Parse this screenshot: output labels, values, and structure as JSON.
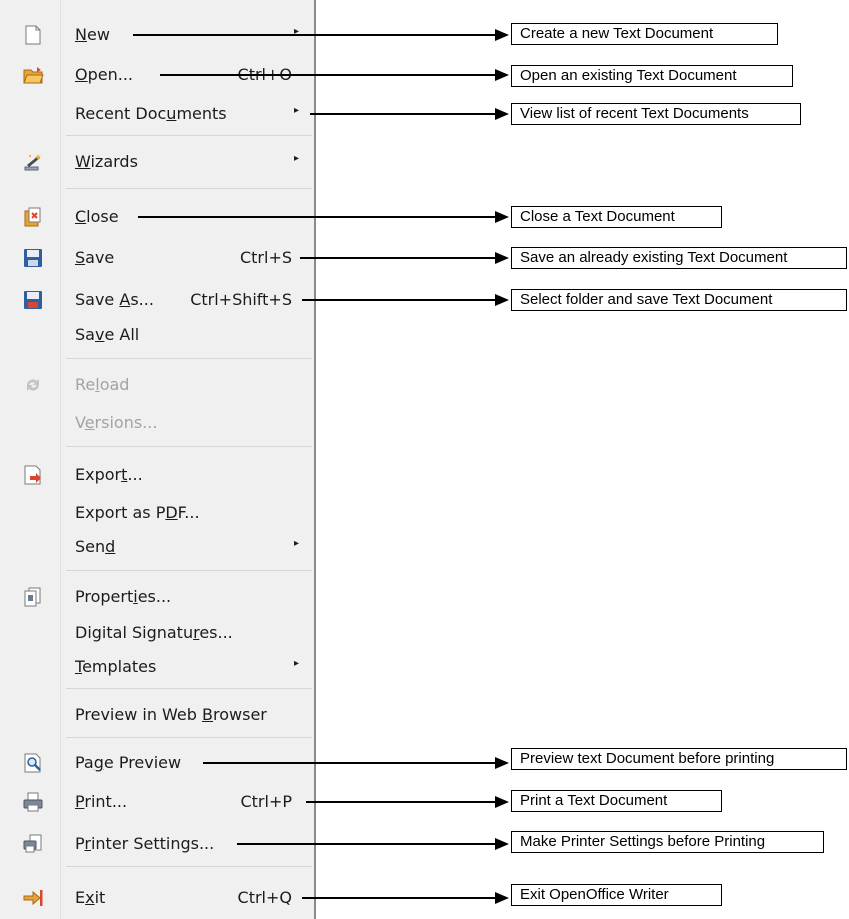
{
  "menu": {
    "items": [
      {
        "label": "New",
        "mnemonic": "N",
        "shortcut": "",
        "submenu": true,
        "enabled": true,
        "icon": "new-document-icon"
      },
      {
        "label": "Open...",
        "mnemonic": "O",
        "shortcut": "Ctrl+O",
        "submenu": false,
        "enabled": true,
        "icon": "open-folder-icon"
      },
      {
        "label": "Recent Documents",
        "mnemonic": "u",
        "shortcut": "",
        "submenu": true,
        "enabled": true,
        "icon": ""
      },
      {
        "label": "Wizards",
        "mnemonic": "W",
        "shortcut": "",
        "submenu": true,
        "enabled": true,
        "icon": "wizard-icon"
      },
      {
        "label": "Close",
        "mnemonic": "C",
        "shortcut": "",
        "submenu": false,
        "enabled": true,
        "icon": "close-document-icon"
      },
      {
        "label": "Save",
        "mnemonic": "S",
        "shortcut": "Ctrl+S",
        "submenu": false,
        "enabled": true,
        "icon": "save-icon"
      },
      {
        "label": "Save As...",
        "mnemonic": "A",
        "shortcut": "Ctrl+Shift+S",
        "submenu": false,
        "enabled": true,
        "icon": "save-as-icon"
      },
      {
        "label": "Save All",
        "mnemonic": "v",
        "shortcut": "",
        "submenu": false,
        "enabled": true,
        "icon": ""
      },
      {
        "label": "Reload",
        "mnemonic": "l",
        "shortcut": "",
        "submenu": false,
        "enabled": false,
        "icon": "reload-icon"
      },
      {
        "label": "Versions...",
        "mnemonic": "e",
        "shortcut": "",
        "submenu": false,
        "enabled": false,
        "icon": ""
      },
      {
        "label": "Export...",
        "mnemonic": "t",
        "shortcut": "",
        "submenu": false,
        "enabled": true,
        "icon": "export-icon"
      },
      {
        "label": "Export as PDF...",
        "mnemonic": "D",
        "shortcut": "",
        "submenu": false,
        "enabled": true,
        "icon": ""
      },
      {
        "label": "Send",
        "mnemonic": "d",
        "shortcut": "",
        "submenu": true,
        "enabled": true,
        "icon": ""
      },
      {
        "label": "Properties...",
        "mnemonic": "i",
        "shortcut": "",
        "submenu": false,
        "enabled": true,
        "icon": "properties-icon"
      },
      {
        "label": "Digital Signatures...",
        "mnemonic": "r",
        "shortcut": "",
        "submenu": false,
        "enabled": true,
        "icon": ""
      },
      {
        "label": "Templates",
        "mnemonic": "T",
        "shortcut": "",
        "submenu": true,
        "enabled": true,
        "icon": ""
      },
      {
        "label": "Preview in Web Browser",
        "mnemonic": "B",
        "shortcut": "",
        "submenu": false,
        "enabled": true,
        "icon": ""
      },
      {
        "label": "Page Preview",
        "mnemonic": "g",
        "shortcut": "",
        "submenu": false,
        "enabled": true,
        "icon": "page-preview-icon"
      },
      {
        "label": "Print...",
        "mnemonic": "P",
        "shortcut": "Ctrl+P",
        "submenu": false,
        "enabled": true,
        "icon": "print-icon"
      },
      {
        "label": "Printer Settings...",
        "mnemonic": "r",
        "shortcut": "",
        "submenu": false,
        "enabled": true,
        "icon": "printer-settings-icon"
      },
      {
        "label": "Exit",
        "mnemonic": "x",
        "shortcut": "Ctrl+Q",
        "submenu": false,
        "enabled": true,
        "icon": "exit-icon"
      }
    ]
  },
  "callouts": [
    {
      "target_item": 0,
      "text": "Create a new Text Document"
    },
    {
      "target_item": 1,
      "text": "Open an existing Text Document"
    },
    {
      "target_item": 2,
      "text": "View list of recent Text Documents"
    },
    {
      "target_item": 4,
      "text": "Close a Text Document"
    },
    {
      "target_item": 5,
      "text": "Save an already existing Text Document"
    },
    {
      "target_item": 6,
      "text": "Select folder and save Text Document"
    },
    {
      "target_item": 17,
      "text": "Preview text Document before printing"
    },
    {
      "target_item": 18,
      "text": "Print a Text Document"
    },
    {
      "target_item": 19,
      "text": "Make Printer Settings before Printing"
    },
    {
      "target_item": 20,
      "text": "Exit OpenOffice Writer"
    }
  ],
  "colors": {
    "menu_background": "#f0f0f0",
    "text": "#1c1c1c",
    "disabled_text": "#a3a3a3",
    "separator": "#d6d6d6",
    "icon_orange": "#e8a23a",
    "icon_blue": "#2f5f9e",
    "icon_red": "#d9462f"
  }
}
